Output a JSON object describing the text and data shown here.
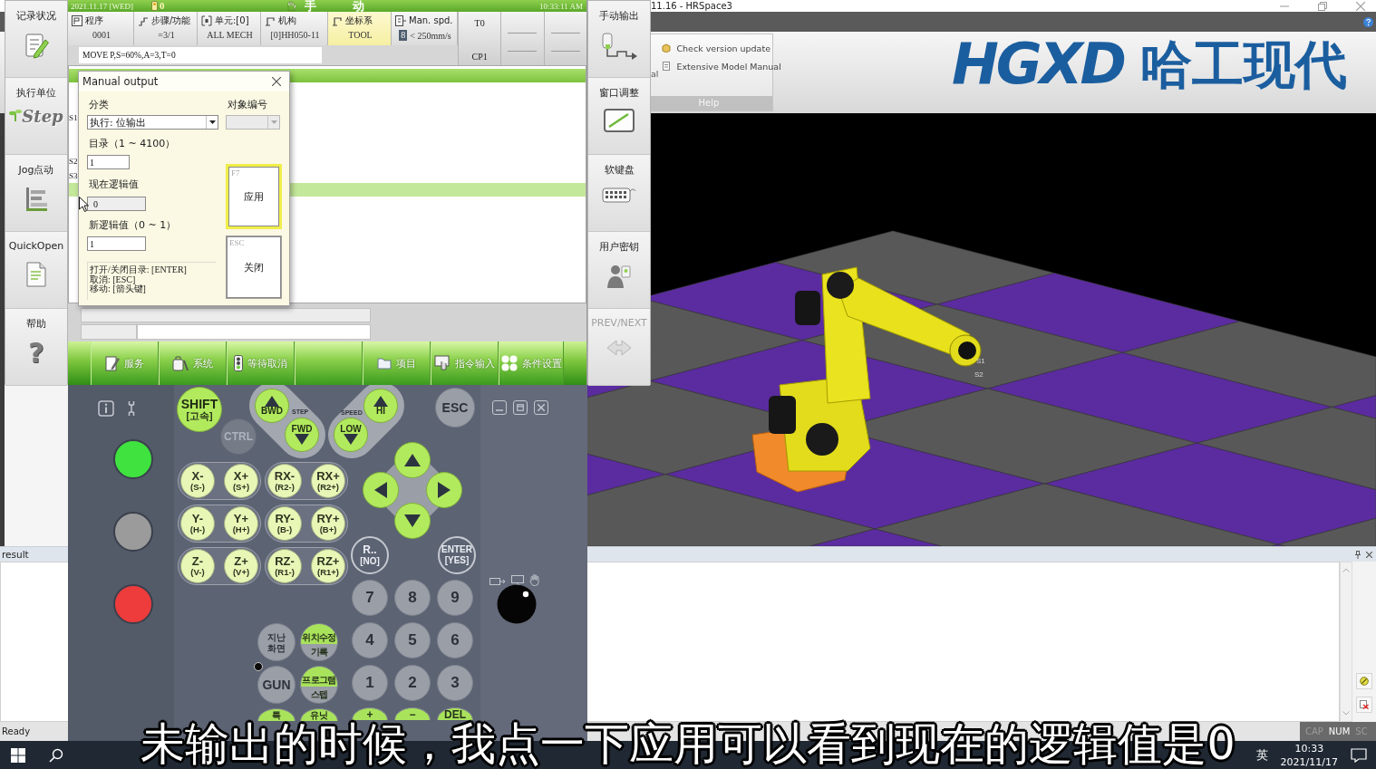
{
  "hrspace": {
    "title": "11.16 - HRSpace3",
    "ribbon": {
      "cut_label": "al",
      "items": [
        {
          "label": "Check version update"
        },
        {
          "label": "Extensive Model Manual"
        }
      ],
      "group": "Help"
    },
    "logo": {
      "mark": "HGXD",
      "name": "哈工现代"
    },
    "viewport": {
      "markers": [
        "S1",
        "S2"
      ]
    },
    "result": {
      "title": "result"
    },
    "status": {
      "text": "Ready",
      "indicators": [
        {
          "label": "CAP",
          "on": false
        },
        {
          "label": "NUM",
          "on": true
        },
        {
          "label": "SC",
          "on": false
        }
      ]
    }
  },
  "pendant": {
    "left_menu": [
      {
        "label": "记录状况"
      },
      {
        "label": "执行单位",
        "icon_text": "Step"
      },
      {
        "label": "Jog点动"
      },
      {
        "label": "QuickOpen"
      },
      {
        "label": "帮助",
        "icon_text": "?"
      }
    ],
    "status": {
      "date": "2021.11.17 [WED]",
      "counter": "0",
      "mode": [
        "手",
        "动"
      ],
      "time": "10:33:11 AM"
    },
    "info": [
      {
        "label": "程序",
        "value": "0001",
        "selected": false
      },
      {
        "label": "步骤/功能",
        "value": "=3/1",
        "selected": false
      },
      {
        "label": "单元:[0]",
        "value": "ALL MECH",
        "selected": false
      },
      {
        "label": "机构",
        "value": "[0]HH050-11",
        "selected": false
      },
      {
        "label": "坐标系",
        "value": "TOOL",
        "selected": true
      },
      {
        "label": "Man. spd.",
        "badge": "8",
        "value": "< 250mm/s",
        "selected": false
      }
    ],
    "tool": {
      "top": "T0",
      "bottom": "CP1"
    },
    "command": "MOVE P,S=60%,A=3,T=0",
    "program_rows": [
      {
        "label": "S1",
        "selected": false
      },
      {
        "label": "S2",
        "selected": false
      },
      {
        "label": "S3",
        "selected": false
      },
      {
        "selected": true
      }
    ],
    "function_keys": [
      {
        "kind": "key",
        "label": "服务"
      },
      {
        "kind": "key",
        "label": "系统"
      },
      {
        "kind": "key",
        "label": "等待取消"
      },
      {
        "kind": "blank"
      },
      {
        "kind": "key",
        "label": "项目"
      },
      {
        "kind": "key",
        "label": "指令输入"
      },
      {
        "kind": "key",
        "label": "条件设置"
      }
    ],
    "right_menu": [
      {
        "label": "手动输出",
        "disabled": false
      },
      {
        "label": "窗口调整",
        "disabled": false
      },
      {
        "label": "软键盘",
        "disabled": false
      },
      {
        "label": "用户密钥",
        "disabled": false
      },
      {
        "label": "PREV/NEXT",
        "disabled": true
      }
    ],
    "keypad": {
      "shift": {
        "label": "SHIFT",
        "sub": "[고속]"
      },
      "ctrl": "CTRL",
      "step": {
        "label": "STEP",
        "back": "BWD",
        "forward": "FWD"
      },
      "speed": {
        "label": "SPEED",
        "high": "HI",
        "low": "LOW"
      },
      "esc": "ESC",
      "jog_keys": [
        {
          "label": "X-",
          "sub": "(S-)"
        },
        {
          "label": "X+",
          "sub": "(S+)"
        },
        {
          "label": "RX-",
          "sub": "(R2-)"
        },
        {
          "label": "RX+",
          "sub": "(R2+)"
        },
        {
          "label": "Y-",
          "sub": "(H-)"
        },
        {
          "label": "Y+",
          "sub": "(H+)"
        },
        {
          "label": "RY-",
          "sub": "(B-)"
        },
        {
          "label": "RY+",
          "sub": "(B+)"
        },
        {
          "label": "Z-",
          "sub": "(V-)"
        },
        {
          "label": "Z+",
          "sub": "(V+)"
        },
        {
          "label": "RZ-",
          "sub": "(R1-)"
        },
        {
          "label": "RZ+",
          "sub": "(R1+)"
        }
      ],
      "confirm_keys": [
        {
          "label": "R..",
          "sub": "[NO]"
        },
        {
          "label": "ENTER",
          "sub": "[YES]"
        }
      ],
      "number_keys": [
        "7",
        "8",
        "9",
        "4",
        "5",
        "6",
        "1",
        "2",
        "3"
      ],
      "side_keys": [
        {
          "kind": "plain",
          "label": "지난",
          "sub": "화면",
          "lamp": false
        },
        {
          "kind": "split",
          "label": "위치수정",
          "sub": "기록",
          "lamp": false
        },
        {
          "kind": "plain",
          "label": "GUN",
          "lamp": true
        },
        {
          "kind": "split",
          "label": "프로그램",
          "sub": "스텝",
          "lamp": false
        },
        {
          "kind": "split",
          "label": "특",
          "lamp": false
        },
        {
          "kind": "split",
          "label": "유닛",
          "lamp": false
        }
      ],
      "edit_keys": [
        {
          "label": "+"
        },
        {
          "label": "−"
        },
        {
          "label": "DEL"
        }
      ],
      "lamps": [
        {
          "color": "#3fe23f"
        },
        {
          "color": "#9b9b9b"
        },
        {
          "color": "#ee3b3b"
        }
      ]
    }
  },
  "dialog": {
    "title": "Manual output",
    "category": {
      "label": "分类",
      "value": "执行: 位输出"
    },
    "target": {
      "label": "对象编号",
      "disabled": true
    },
    "index": {
      "label": "目录（1 ~ 4100）",
      "value": "1"
    },
    "current": {
      "label": "现在逻辑值",
      "value": "0",
      "disabled": true
    },
    "new_value": {
      "label": "新逻辑值（0 ~ 1）",
      "value": "1"
    },
    "help_lines": [
      "打开/关闭目录: [ENTER]",
      "取消: [ESC]",
      "移动: [箭头键]"
    ],
    "apply": {
      "key": "F7",
      "label": "应用",
      "focused": true
    },
    "close": {
      "key": "ESC",
      "label": "关闭",
      "focused": false
    }
  },
  "taskbar": {
    "input_method": "英",
    "time": "10:33",
    "date": "2021/11/17"
  },
  "subtitle": "未输出的时候，我点一下应用可以看到现在的逻辑值是0"
}
